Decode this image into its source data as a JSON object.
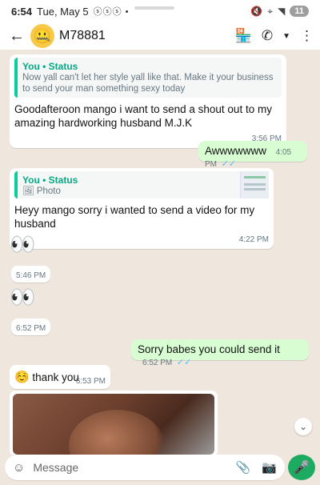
{
  "status_bar": {
    "time": "6:54",
    "date": "Tue, May 5",
    "notifications": "ⓢⓢⓢ •",
    "battery": "11"
  },
  "header": {
    "contact_name": "M78881",
    "back_icon": "arrow-left",
    "avatar_emoji": "🤐"
  },
  "messages": {
    "m1": {
      "quote_author": "You • Status",
      "quote_text": "Now yall can't let her style yall like that. Make it your business to send your man something sexy today",
      "text": "Goodafteroon mango i want to send a shout out to my amazing hardworking husband M.J.K",
      "time": "3:56 PM",
      "reaction": "❤️"
    },
    "m2": {
      "text": "Awwwwwww",
      "time": "4:05 PM",
      "ticks": "✓✓"
    },
    "m3": {
      "quote_author": "You • Status",
      "quote_text": "Photo",
      "text": "Heyy mango sorry i wanted to send a video for my husband",
      "time": "4:22 PM"
    },
    "m4": {
      "emoji": "👀",
      "time": "5:46 PM"
    },
    "m5": {
      "emoji": "👀",
      "time": "6:52 PM"
    },
    "m6": {
      "text": "Sorry babes you could send it",
      "time": "6:52 PM",
      "ticks": "✓✓"
    },
    "m7": {
      "emoji": "☺️",
      "text": "thank you",
      "time": "6:53 PM"
    }
  },
  "composer": {
    "placeholder": "Message"
  }
}
